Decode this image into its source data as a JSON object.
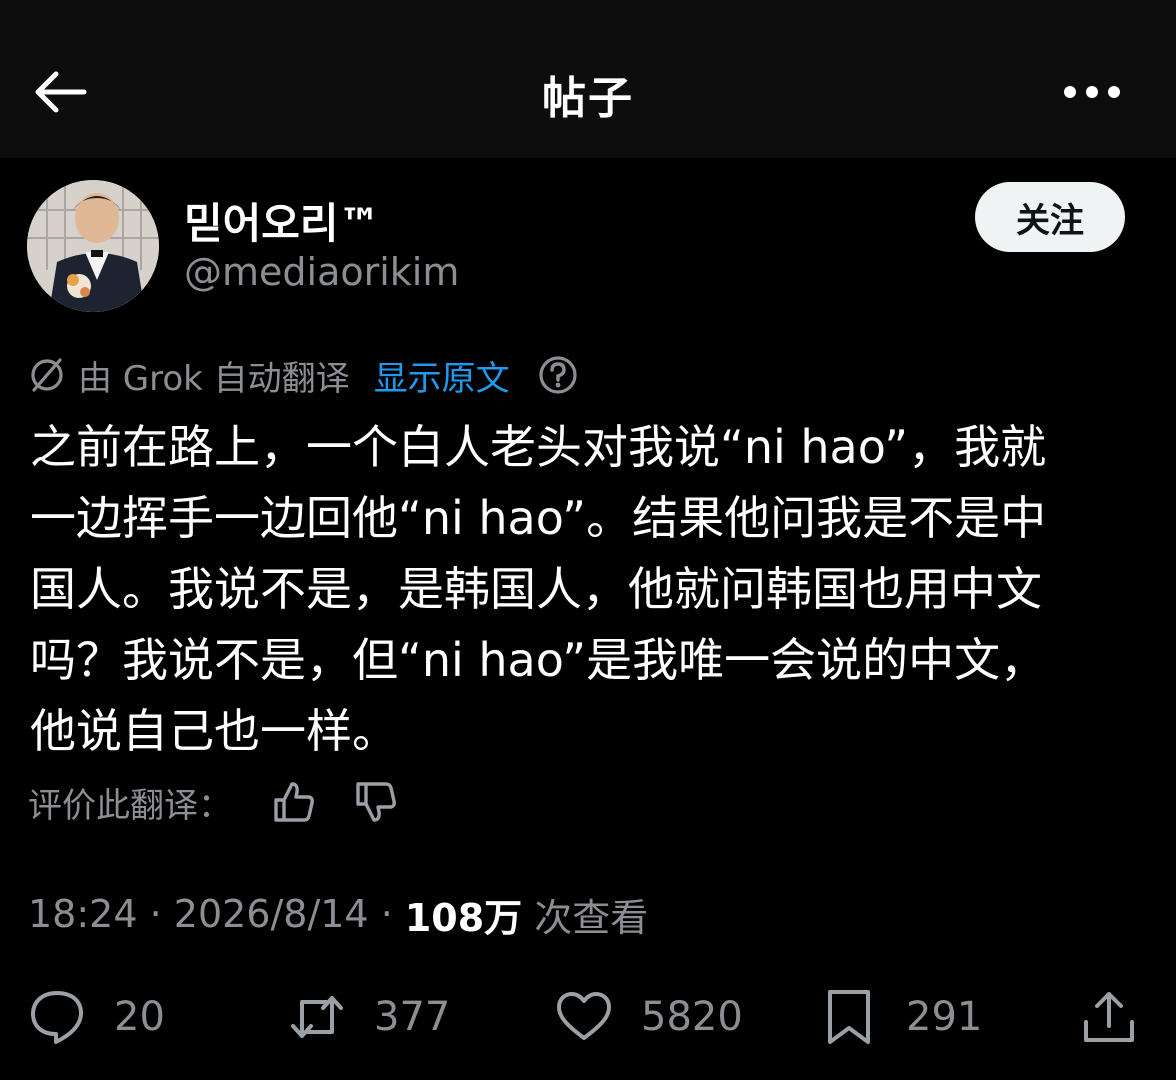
{
  "header": {
    "title": "帖子",
    "back_icon": "arrow-left-icon",
    "more_icon": "more-horizontal-icon"
  },
  "author": {
    "display_name": "믿어오리™",
    "handle": "@mediaorikim",
    "follow_label": "关注"
  },
  "translation": {
    "notice": "由 Grok 自动翻译",
    "show_original": "显示原文",
    "help_icon": "question-circle-icon"
  },
  "tweet": {
    "text": "之前在路上，一个白人老头对我说“ni hao”，我就\n一边挥手一边回他“ni hao”。结果他问我是不是中\n国人。我说不是，是韩国人，他就问韩国也用中文\n吗？我说不是，但“ni hao”是我唯一会说的中文，\n他说自己也一样。"
  },
  "rating": {
    "label": "评价此翻译："
  },
  "meta": {
    "time": "18:24",
    "sep1": " · ",
    "date": "2026/8/14",
    "sep2": " · ",
    "views": "108万",
    "views_label": " 次查看"
  },
  "actions": {
    "replies": "20",
    "retweets": "377",
    "likes": "5820",
    "bookmarks": "291"
  },
  "colors": {
    "accent": "#1d9bf0",
    "secondary_text": "#8b8f94",
    "background": "#000000",
    "header_bg": "#0d0d0d"
  }
}
